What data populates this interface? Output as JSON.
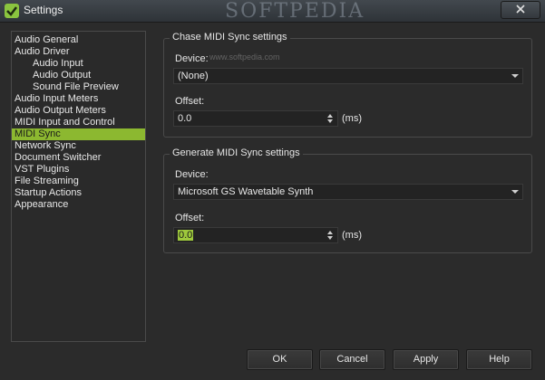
{
  "window": {
    "title": "Settings",
    "watermark": "SOFTPEDIA"
  },
  "tree": {
    "items": [
      {
        "label": "Audio General",
        "level": 0
      },
      {
        "label": "Audio Driver",
        "level": 0
      },
      {
        "label": "Audio Input",
        "level": 1
      },
      {
        "label": "Audio Output",
        "level": 1
      },
      {
        "label": "Sound File Preview",
        "level": 1
      },
      {
        "label": "Audio Input Meters",
        "level": 0
      },
      {
        "label": "Audio Output Meters",
        "level": 0
      },
      {
        "label": "MIDI Input and Control",
        "level": 0
      },
      {
        "label": "MIDI Sync",
        "level": 0,
        "selected": true
      },
      {
        "label": "Network Sync",
        "level": 0
      },
      {
        "label": "Document Switcher",
        "level": 0
      },
      {
        "label": "VST Plugins",
        "level": 0
      },
      {
        "label": "File Streaming",
        "level": 0
      },
      {
        "label": "Startup Actions",
        "level": 0
      },
      {
        "label": "Appearance",
        "level": 0
      }
    ]
  },
  "chase": {
    "title": "Chase MIDI Sync settings",
    "watermark": "www.softpedia.com",
    "device_label": "Device:",
    "device_value": "(None)",
    "offset_label": "Offset:",
    "offset_value": "0.0",
    "unit": "(ms)"
  },
  "generate": {
    "title": "Generate MIDI Sync settings",
    "device_label": "Device:",
    "device_value": "Microsoft GS Wavetable Synth",
    "offset_label": "Offset:",
    "offset_value": "0.0",
    "unit": "(ms)"
  },
  "buttons": {
    "ok": "OK",
    "cancel": "Cancel",
    "apply": "Apply",
    "help": "Help"
  },
  "colors": {
    "accent": "#8cb830",
    "background": "#2b2b2b"
  }
}
